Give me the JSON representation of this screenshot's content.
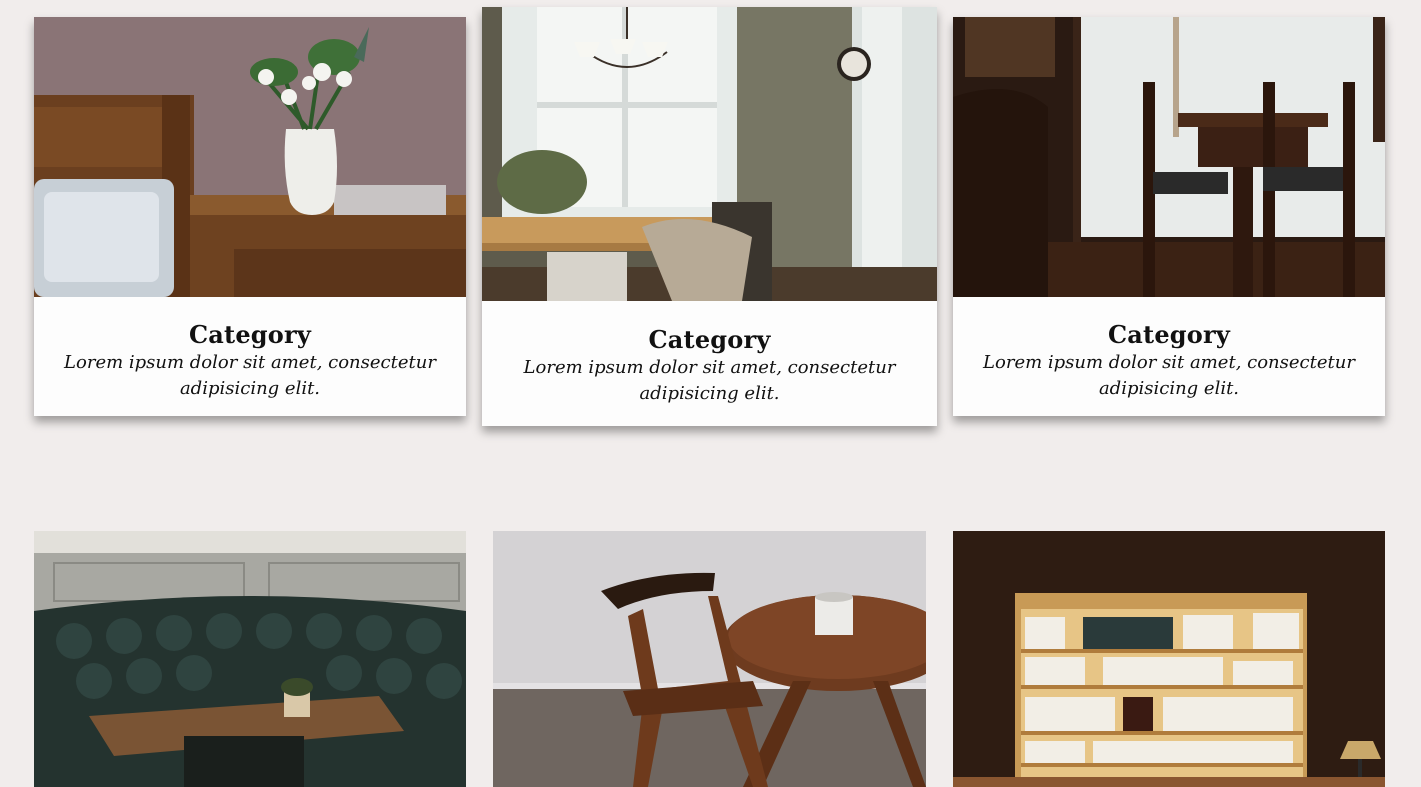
{
  "cards": [
    {
      "title": "Category",
      "description": "Lorem ipsum dolor sit amet, consectetur adipisicing elit.",
      "image": "bedroom-nightstand-tulips-photo"
    },
    {
      "title": "Category",
      "description": "Lorem ipsum dolor sit amet, consectetur adipisicing elit.",
      "image": "dining-room-window-chandelier-photo"
    },
    {
      "title": "Category",
      "description": "Lorem ipsum dolor sit amet, consectetur adipisicing elit.",
      "image": "cafe-table-chairs-photo"
    },
    {
      "image": "leather-booth-cafe-photo"
    },
    {
      "image": "wooden-chair-round-table-photo"
    },
    {
      "image": "lit-bookshelf-photo"
    }
  ],
  "colors": {
    "background": "#f1edec",
    "card": "#fdfdfd",
    "text": "#111111"
  }
}
